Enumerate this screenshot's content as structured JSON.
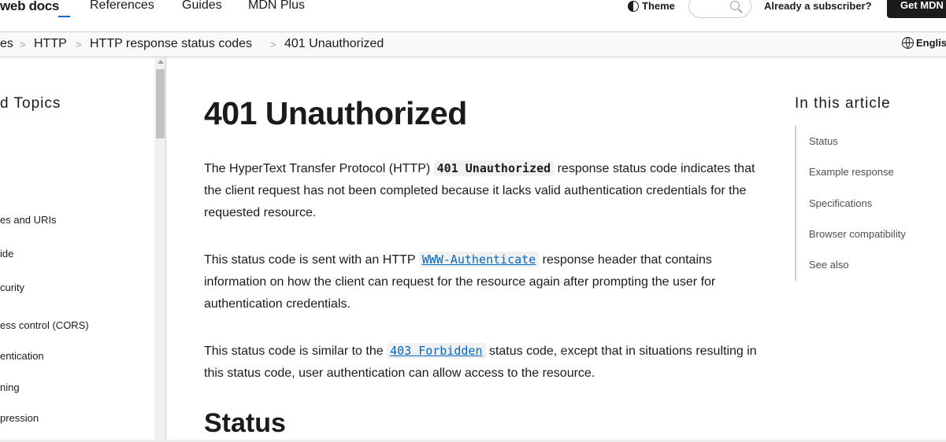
{
  "topnav": {
    "logo_text": "web docs",
    "links": [
      "References",
      "Guides",
      "MDN Plus"
    ],
    "theme_label": "Theme",
    "search_placeholder": "",
    "subscriber_label": "Already a subscriber?",
    "get_button_label": "Get MDN"
  },
  "breadcrumb": {
    "items": [
      "es",
      "HTTP",
      "HTTP response status codes",
      "401 Unauthorized"
    ],
    "separator": ">",
    "language_label": "Englis"
  },
  "sidebar": {
    "title": "d Topics",
    "items": [
      "es and URIs",
      "ide",
      "curity",
      "ess control (CORS)",
      "entication",
      "ning",
      "pression"
    ]
  },
  "main": {
    "title": "401 Unauthorized",
    "p1": {
      "before": "The HyperText Transfer Protocol (HTTP) ",
      "code": "401 Unauthorized",
      "after": " response status code indicates that the client request has not been completed because it lacks valid authentication credentials for the requested resource."
    },
    "p2": {
      "before": "This status code is sent with an HTTP ",
      "link": "WWW-Authenticate",
      "after": " response header that contains information on how the client can request for the resource again after prompting the user for authentication credentials."
    },
    "p3": {
      "before": "This status code is similar to the ",
      "link": "403 Forbidden",
      "after": " status code, except that in situations resulting in this status code, user authentication can allow access to the resource."
    },
    "section_heading": "Status"
  },
  "toc": {
    "title": "In this article",
    "items": [
      "Status",
      "Example response",
      "Specifications",
      "Browser compatibility",
      "See also"
    ]
  },
  "colors": {
    "link": "#0069c2",
    "text": "#1b1b1b",
    "border": "#cdcdcd",
    "button_bg": "#1b1b1b"
  }
}
